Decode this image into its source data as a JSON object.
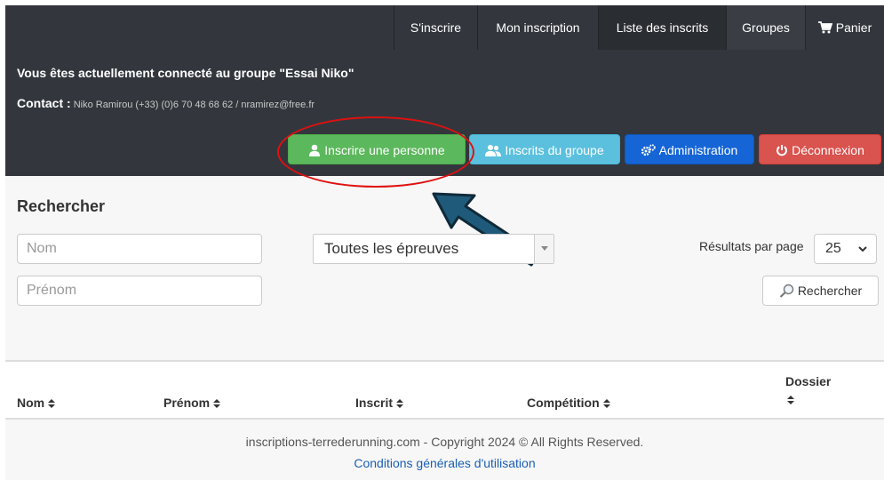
{
  "nav": {
    "signup": "S'inscrire",
    "my_registration": "Mon inscription",
    "registered_list": "Liste des inscrits",
    "groups": "Groupes",
    "cart": "Panier"
  },
  "group": {
    "title": "Vous êtes actuellement connecté au groupe \"Essai Niko\"",
    "contact_label": "Contact :",
    "contact_info": "Niko Ramirou (+33) (0)6 70 48 68 62 / nramirez@free.fr"
  },
  "actions": {
    "register_person": "Inscrire une personne",
    "group_members": "Inscrits du groupe",
    "administration": "Administration",
    "logout": "Déconnexion"
  },
  "search": {
    "title": "Rechercher",
    "nom_placeholder": "Nom",
    "prenom_placeholder": "Prénom",
    "event_selected": "Toutes les épreuves",
    "results_per_page_label": "Résultats par page",
    "results_per_page_value": "25",
    "search_button": "Rechercher"
  },
  "table": {
    "columns": [
      "Nom",
      "Prénom",
      "Inscrit",
      "Compétition",
      "Dossier"
    ]
  },
  "footer": {
    "copyright": "inscriptions-terrederunning.com - Copyright 2024 © All Rights Reserved.",
    "terms_link": "Conditions générales d'utilisation"
  },
  "colors": {
    "nav_bg": "#33373d",
    "green": "#5cb85c",
    "cyan": "#5bc0de",
    "blue": "#1565d6",
    "red": "#d9534f",
    "annotation": "#e01010",
    "arrow": "#1f5a7a"
  }
}
